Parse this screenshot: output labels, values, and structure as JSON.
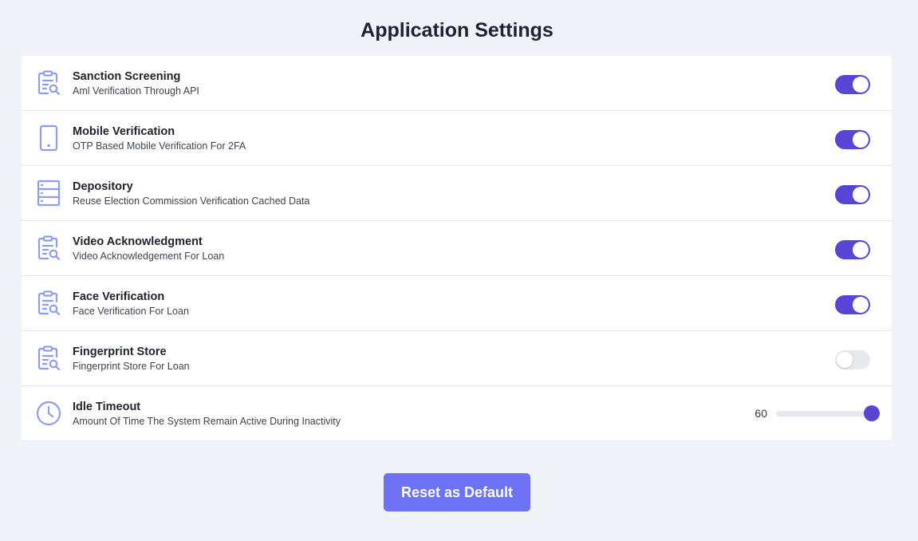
{
  "page": {
    "title": "Application Settings"
  },
  "colors": {
    "accent": "#5745d6",
    "icon": "#8e9cf3",
    "button": "#6e72f5",
    "toggle_off": "#e8e9ee",
    "background": "#f0f3f8"
  },
  "settings": [
    {
      "title": "Sanction Screening",
      "description": "Aml Verification Through API",
      "icon": "clipboard-search-icon",
      "enabled": true
    },
    {
      "title": "Mobile Verification",
      "description": "OTP Based Mobile Verification For 2FA",
      "icon": "mobile-phone-icon",
      "enabled": true
    },
    {
      "title": "Depository",
      "description": "Reuse Election Commission Verification Cached Data",
      "icon": "server-storage-icon",
      "enabled": true
    },
    {
      "title": "Video Acknowledgment",
      "description": "Video Acknowledgement For Loan",
      "icon": "clipboard-search-icon",
      "enabled": true
    },
    {
      "title": "Face Verification",
      "description": "Face Verification For Loan",
      "icon": "clipboard-search-icon",
      "enabled": true
    },
    {
      "title": "Fingerprint Store",
      "description": "Fingerprint Store For Loan",
      "icon": "clipboard-search-icon",
      "enabled": false
    }
  ],
  "idle_timeout": {
    "title": "Idle Timeout",
    "description": "Amount Of Time The System Remain Active During Inactivity",
    "icon": "clock-icon",
    "value": "60",
    "slider_fraction": 1.0
  },
  "actions": {
    "reset_label": "Reset as Default"
  }
}
